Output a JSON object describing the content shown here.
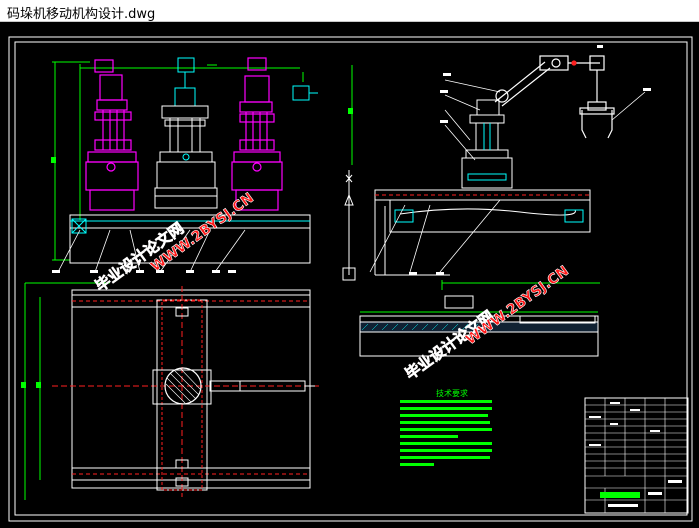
{
  "window": {
    "title": "码垛机移动机构设计.dwg"
  },
  "drawing": {
    "notes_title": "技术要求",
    "watermark_text": "毕业设计论文网",
    "watermark_url": "WWW.2BYSJ.CN",
    "colors": {
      "background": "#000000",
      "border": "#ffffff",
      "magenta": "#ff00ff",
      "cyan": "#00ffff",
      "green": "#00ff00",
      "red": "#ff2020",
      "yellow": "#ffff00",
      "watermark_fill": "#ff1a1a",
      "watermark_stroke": "#ffffff"
    }
  }
}
